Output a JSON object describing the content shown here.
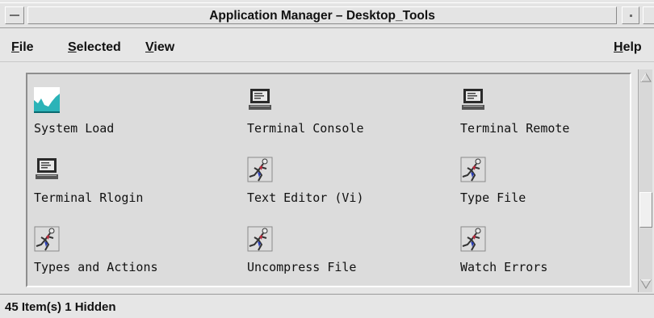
{
  "window": {
    "title": "Application Manager – Desktop_Tools"
  },
  "menubar": {
    "file": "File",
    "selected": "Selected",
    "view": "View",
    "help": "Help"
  },
  "items": [
    {
      "label": "System Load",
      "icon": "system-load-icon"
    },
    {
      "label": "Terminal Console",
      "icon": "terminal-icon"
    },
    {
      "label": "Terminal Remote",
      "icon": "terminal-icon"
    },
    {
      "label": "Terminal Rlogin",
      "icon": "terminal-icon"
    },
    {
      "label": "Text Editor (Vi)",
      "icon": "runner-icon"
    },
    {
      "label": "Type File",
      "icon": "runner-icon"
    },
    {
      "label": "Types and Actions",
      "icon": "runner-icon"
    },
    {
      "label": "Uncompress File",
      "icon": "runner-icon"
    },
    {
      "label": "Watch Errors",
      "icon": "runner-icon"
    }
  ],
  "status": {
    "text": "45 Item(s) 1 Hidden"
  },
  "colors": {
    "background": "#e6e6e6",
    "pane": "#dcdcdc",
    "load_chart": "#2bb3b8"
  }
}
